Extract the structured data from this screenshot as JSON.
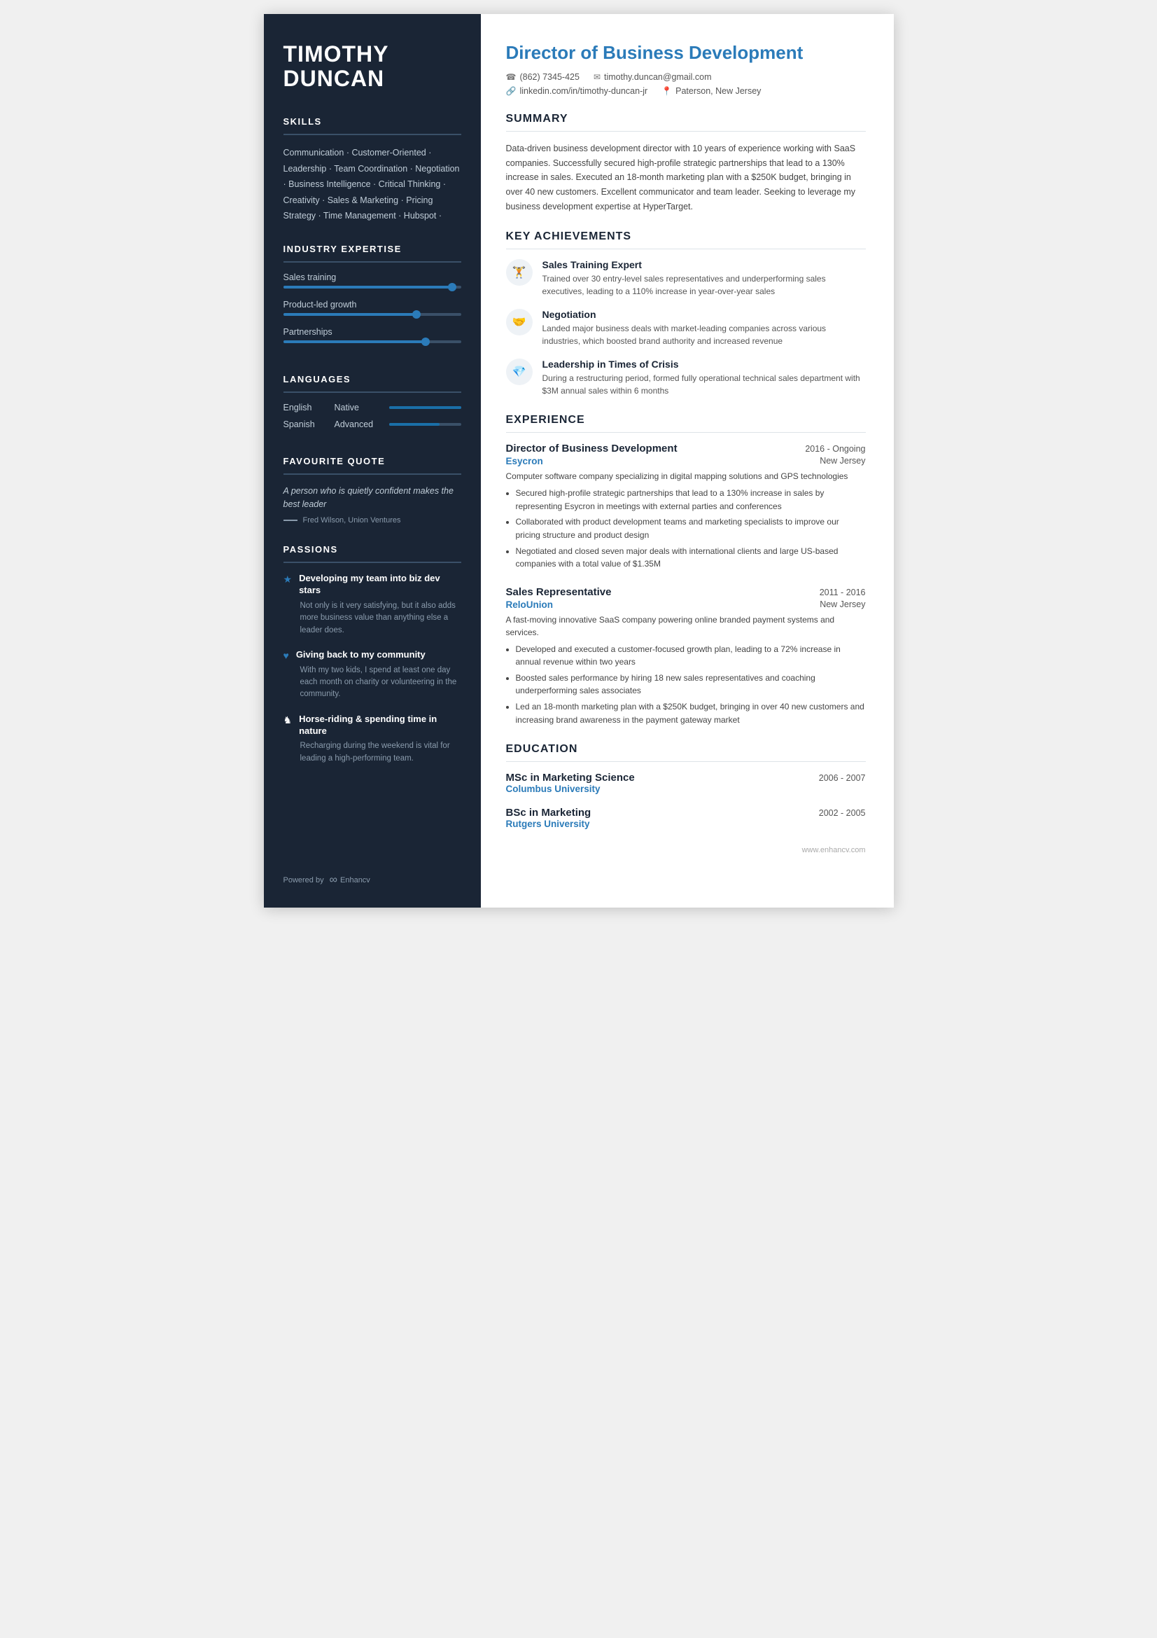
{
  "person": {
    "first_name": "TIMOTHY",
    "last_name": "DUNCAN",
    "job_title": "Director of Business Development"
  },
  "contact": {
    "phone": "(862) 7345-425",
    "email": "timothy.duncan@gmail.com",
    "linkedin": "linkedin.com/in/timothy-duncan-jr",
    "location": "Paterson, New Jersey"
  },
  "sidebar": {
    "skills_title": "SKILLS",
    "skills": "Communication · Customer-Oriented · Leadership · Team Coordination · Negotiation · Business Intelligence · Critical Thinking · Creativity · Sales & Marketing · Pricing Strategy · Time Management · Hubspot ·",
    "expertise_title": "INDUSTRY EXPERTISE",
    "expertise": [
      {
        "label": "Sales training",
        "percent": 95,
        "color": "#2b7bb9"
      },
      {
        "label": "Product-led growth",
        "percent": 75,
        "color": "#2b7bb9"
      },
      {
        "label": "Partnerships",
        "percent": 80,
        "color": "#2b7bb9"
      }
    ],
    "languages_title": "LANGUAGES",
    "languages": [
      {
        "name": "English",
        "level": "Native",
        "percent": 100
      },
      {
        "name": "Spanish",
        "level": "Advanced",
        "percent": 70
      }
    ],
    "quote_title": "FAVOURITE QUOTE",
    "quote_text": "A person who is quietly confident makes the best leader",
    "quote_author": "Fred Wilson, Union Ventures",
    "passions_title": "PASSIONS",
    "passions": [
      {
        "icon": "★",
        "title": "Developing my team into biz dev stars",
        "desc": "Not only is it very satisfying, but it also adds more business value than anything else a leader does.",
        "icon_color": "#2b7bb9"
      },
      {
        "icon": "♥",
        "title": "Giving back to my community",
        "desc": "With my two kids, I spend at least one day each month on charity or volunteering in the community.",
        "icon_color": "#2b7bb9"
      },
      {
        "icon": "♞",
        "title": "Horse-riding & spending time in nature",
        "desc": "Recharging during the weekend is vital for leading a high-performing team.",
        "icon_color": "white"
      }
    ],
    "footer_powered": "Powered by",
    "footer_brand": "Enhancv"
  },
  "summary": {
    "title": "SUMMARY",
    "text": "Data-driven business development director with 10 years of experience working with SaaS companies. Successfully secured high-profile strategic partnerships that lead to a 130% increase in sales. Executed an 18-month marketing plan with a $250K budget, bringing in over 40 new customers. Excellent communicator and team leader. Seeking to leverage my business development expertise at HyperTarget."
  },
  "achievements": {
    "title": "KEY ACHIEVEMENTS",
    "items": [
      {
        "icon": "🏋",
        "title": "Sales Training Expert",
        "desc": "Trained over 30 entry-level sales representatives and underperforming sales executives, leading to a 110% increase in year-over-year sales"
      },
      {
        "icon": "🤝",
        "title": "Negotiation",
        "desc": "Landed major business deals with market-leading companies across various industries, which boosted brand authority and increased revenue"
      },
      {
        "icon": "💎",
        "title": "Leadership in Times of Crisis",
        "desc": "During a restructuring period, formed fully operational technical sales department with $3M annual sales within 6 months"
      }
    ]
  },
  "experience": {
    "title": "EXPERIENCE",
    "items": [
      {
        "role": "Director of Business Development",
        "dates": "2016 - Ongoing",
        "company": "Esycron",
        "location": "New Jersey",
        "desc": "Computer software company specializing in digital mapping solutions and GPS technologies",
        "bullets": [
          "Secured high-profile strategic partnerships that lead to a 130% increase in sales by representing Esycron in meetings with external parties and conferences",
          "Collaborated with product development teams and marketing specialists to improve our pricing structure and product design",
          "Negotiated and closed seven major deals with international clients and large US-based companies with a total value of $1.35M"
        ]
      },
      {
        "role": "Sales Representative",
        "dates": "2011 - 2016",
        "company": "ReloUnion",
        "location": "New Jersey",
        "desc": "A fast-moving innovative SaaS company powering online branded payment systems and services.",
        "bullets": [
          "Developed and executed a customer-focused growth plan, leading to a 72% increase in annual revenue within two years",
          "Boosted sales performance by hiring 18 new sales representatives and coaching underperforming sales associates",
          "Led an 18-month marketing plan with a $250K budget, bringing in over 40 new customers and increasing brand awareness in the payment gateway market"
        ]
      }
    ]
  },
  "education": {
    "title": "EDUCATION",
    "items": [
      {
        "degree": "MSc in Marketing Science",
        "dates": "2006 - 2007",
        "school": "Columbus University"
      },
      {
        "degree": "BSc in Marketing",
        "dates": "2002 - 2005",
        "school": "Rutgers University"
      }
    ]
  },
  "footer": {
    "website": "www.enhancv.com"
  }
}
